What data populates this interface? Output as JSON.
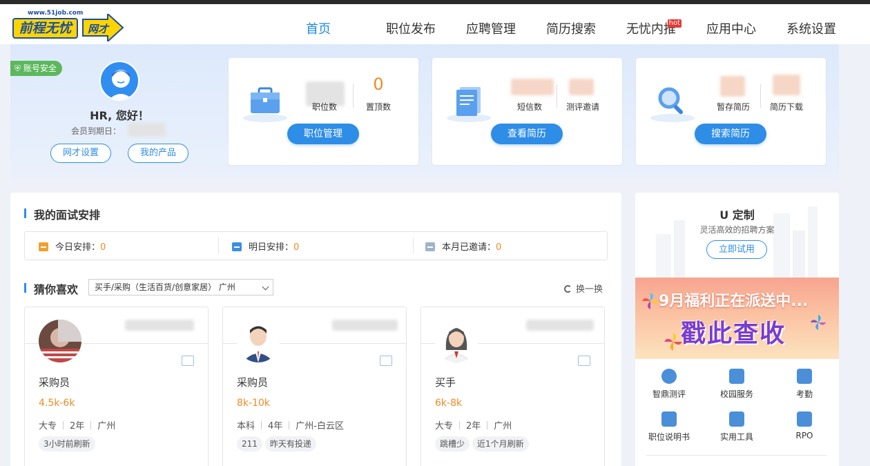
{
  "logo": {
    "url": "www.51job.com",
    "main": "前程无忧",
    "sub": "网才"
  },
  "nav": {
    "items": [
      {
        "label": "首页",
        "active": true
      },
      {
        "label": "职位发布"
      },
      {
        "label": "应聘管理"
      },
      {
        "label": "简历搜索"
      },
      {
        "label": "无忧内推",
        "badge": "hot"
      },
      {
        "label": "应用中心"
      },
      {
        "label": "系统设置"
      }
    ]
  },
  "profile": {
    "safe_badge": "账号安全",
    "greeting": "HR, 您好！",
    "member_label": "会员到期日：",
    "btn_settings": "网才设置",
    "btn_products": "我的产品"
  },
  "cards": [
    {
      "stat1_label": "职位数",
      "stat2_value": "0",
      "stat2_label": "置顶数",
      "button": "职位管理"
    },
    {
      "stat1_label": "短信数",
      "stat2_label": "测评邀请",
      "button": "查看简历"
    },
    {
      "stat1_label": "暂存简历",
      "stat2_label": "简历下载",
      "button": "搜索简历"
    }
  ],
  "interview": {
    "title": "我的面试安排",
    "today_label": "今日安排：",
    "today_value": "0",
    "tomorrow_label": "明日安排：",
    "tomorrow_value": "0",
    "month_label": "本月已邀请：",
    "month_value": "0"
  },
  "guess": {
    "title": "猜你喜欢",
    "select_value": "买手/采购（生活百货/创意家居） 广州",
    "refresh": "换一换"
  },
  "candidates": [
    {
      "name": "采购员",
      "salary": "4.5k-6k",
      "edu": "大专",
      "exp": "2年",
      "city": "广州",
      "tags": [
        "3小时前刷新"
      ]
    },
    {
      "name": "采购员",
      "salary": "8k-10k",
      "edu": "本科",
      "exp": "4年",
      "city": "广州-白云区",
      "tags": [
        "211",
        "昨天有投递"
      ]
    },
    {
      "name": "买手",
      "salary": "6k-8k",
      "edu": "大专",
      "exp": "2年",
      "city": "广州",
      "tags": [
        "跳槽少",
        "近1个月刷新"
      ]
    }
  ],
  "ucustom": {
    "title": "U 定制",
    "subtitle": "灵活高效的招聘方案",
    "button": "立即试用"
  },
  "banner": {
    "line1": "9月福利正在派送中...",
    "line2": "戳此查收"
  },
  "tools": [
    {
      "label": "智鼎测评"
    },
    {
      "label": "校园服务"
    },
    {
      "label": "考勤"
    },
    {
      "label": "职位说明书"
    },
    {
      "label": "实用工具"
    },
    {
      "label": "RPO"
    }
  ],
  "colors": {
    "primary": "#2e8de6",
    "accent": "#f08a24"
  }
}
